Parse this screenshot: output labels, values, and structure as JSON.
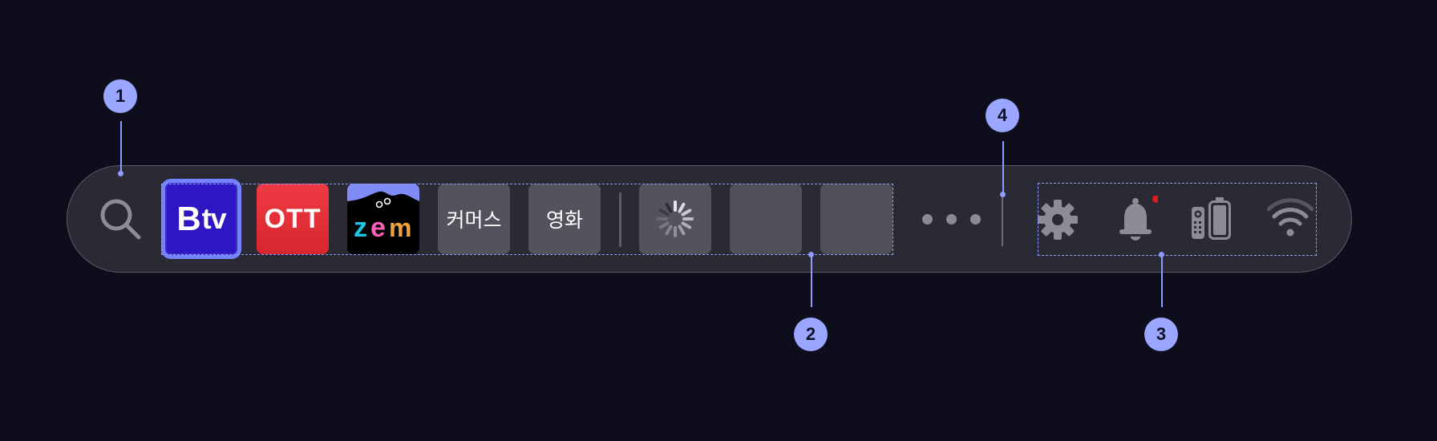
{
  "apps": [
    {
      "name": "Btv",
      "label_main": "B",
      "label_sub": "tv",
      "color": "#2e16c2",
      "focused": true
    },
    {
      "name": "OTT",
      "label": "OTT",
      "color": "#e8333a"
    },
    {
      "name": "ZEM",
      "label": "zem",
      "color": "#000000"
    },
    {
      "name": "commerce",
      "label": "커머스"
    },
    {
      "name": "movie",
      "label": "영화"
    }
  ],
  "placeholders": [
    {
      "state": "loading"
    },
    {
      "state": "empty"
    },
    {
      "state": "empty"
    }
  ],
  "more_label": "more",
  "system_icons": [
    "gear-icon",
    "bell-icon",
    "remote-battery-icon",
    "wifi-icon"
  ],
  "notification_dot_color": "#e0181f",
  "callouts": [
    "1",
    "2",
    "3",
    "4"
  ],
  "accent_color": "#8f9bff",
  "icons": {
    "search": "search-icon"
  }
}
